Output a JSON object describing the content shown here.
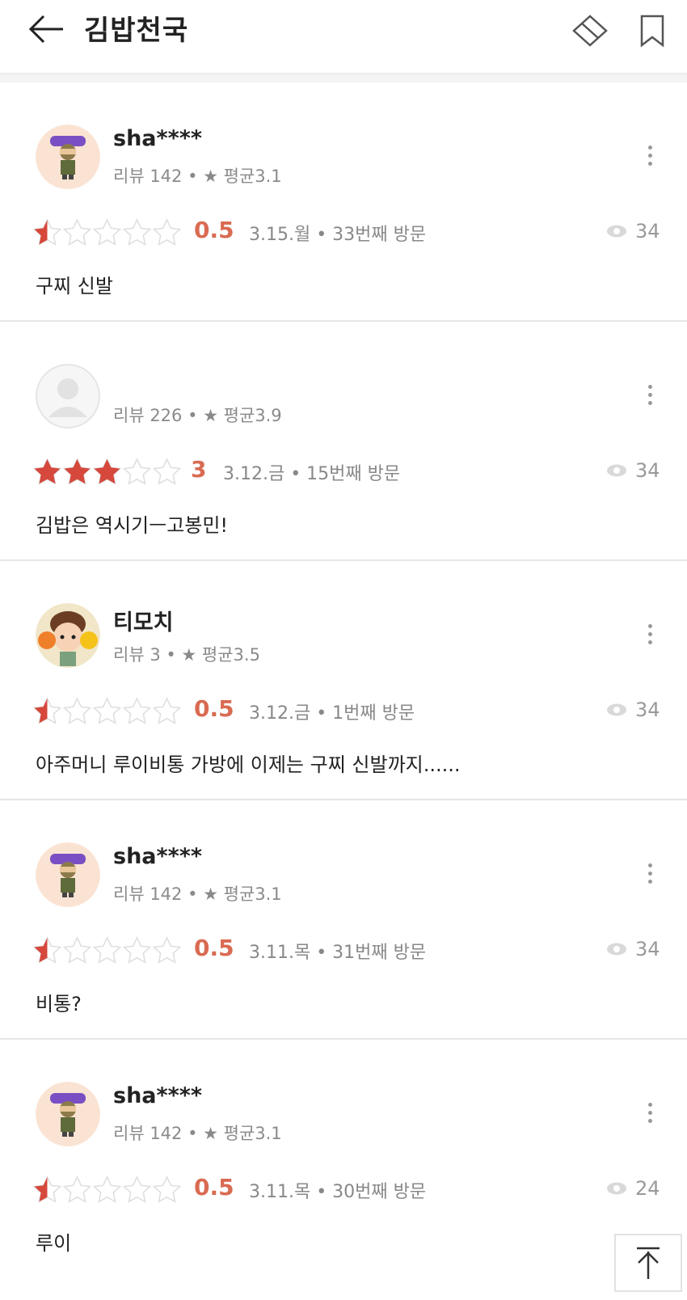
{
  "header": {
    "title": "김밥천국",
    "back_icon": "arrow-left-icon",
    "share_icon": "share-icon",
    "bookmark_icon": "bookmark-icon"
  },
  "colors": {
    "star_filled": "#d6483c",
    "star_empty": "#dfdfdf",
    "score": "#d96b52"
  },
  "reviews": [
    {
      "username": "sha****",
      "meta": "리뷰 142 • ★ 평균3.1",
      "rating": 0.5,
      "score_text": "0.5",
      "date_visit": "3.15.월 • 33번째 방문",
      "views": "34",
      "comment": "구찌 신발"
    },
    {
      "username": "",
      "meta": "리뷰 226 • ★ 평균3.9",
      "rating": 3,
      "score_text": "3",
      "date_visit": "3.12.금 • 15번째 방문",
      "views": "34",
      "comment": "김밥은 역시기ㅡ고봉민!"
    },
    {
      "username": "티모치",
      "meta": "리뷰 3 • ★ 평균3.5",
      "rating": 0.5,
      "score_text": "0.5",
      "date_visit": "3.12.금 • 1번째 방문",
      "views": "34",
      "comment": "아주머니 루이비통 가방에 이제는 구찌 신발까지......"
    },
    {
      "username": "sha****",
      "meta": "리뷰 142 • ★ 평균3.1",
      "rating": 0.5,
      "score_text": "0.5",
      "date_visit": "3.11.목 • 31번째 방문",
      "views": "34",
      "comment": "비통?"
    },
    {
      "username": "sha****",
      "meta": "리뷰 142 • ★ 평균3.1",
      "rating": 0.5,
      "score_text": "0.5",
      "date_visit": "3.11.목 • 30번째 방문",
      "views": "24",
      "comment": "루이"
    }
  ],
  "scroll_top_icon": "arrow-up-to-top-icon"
}
